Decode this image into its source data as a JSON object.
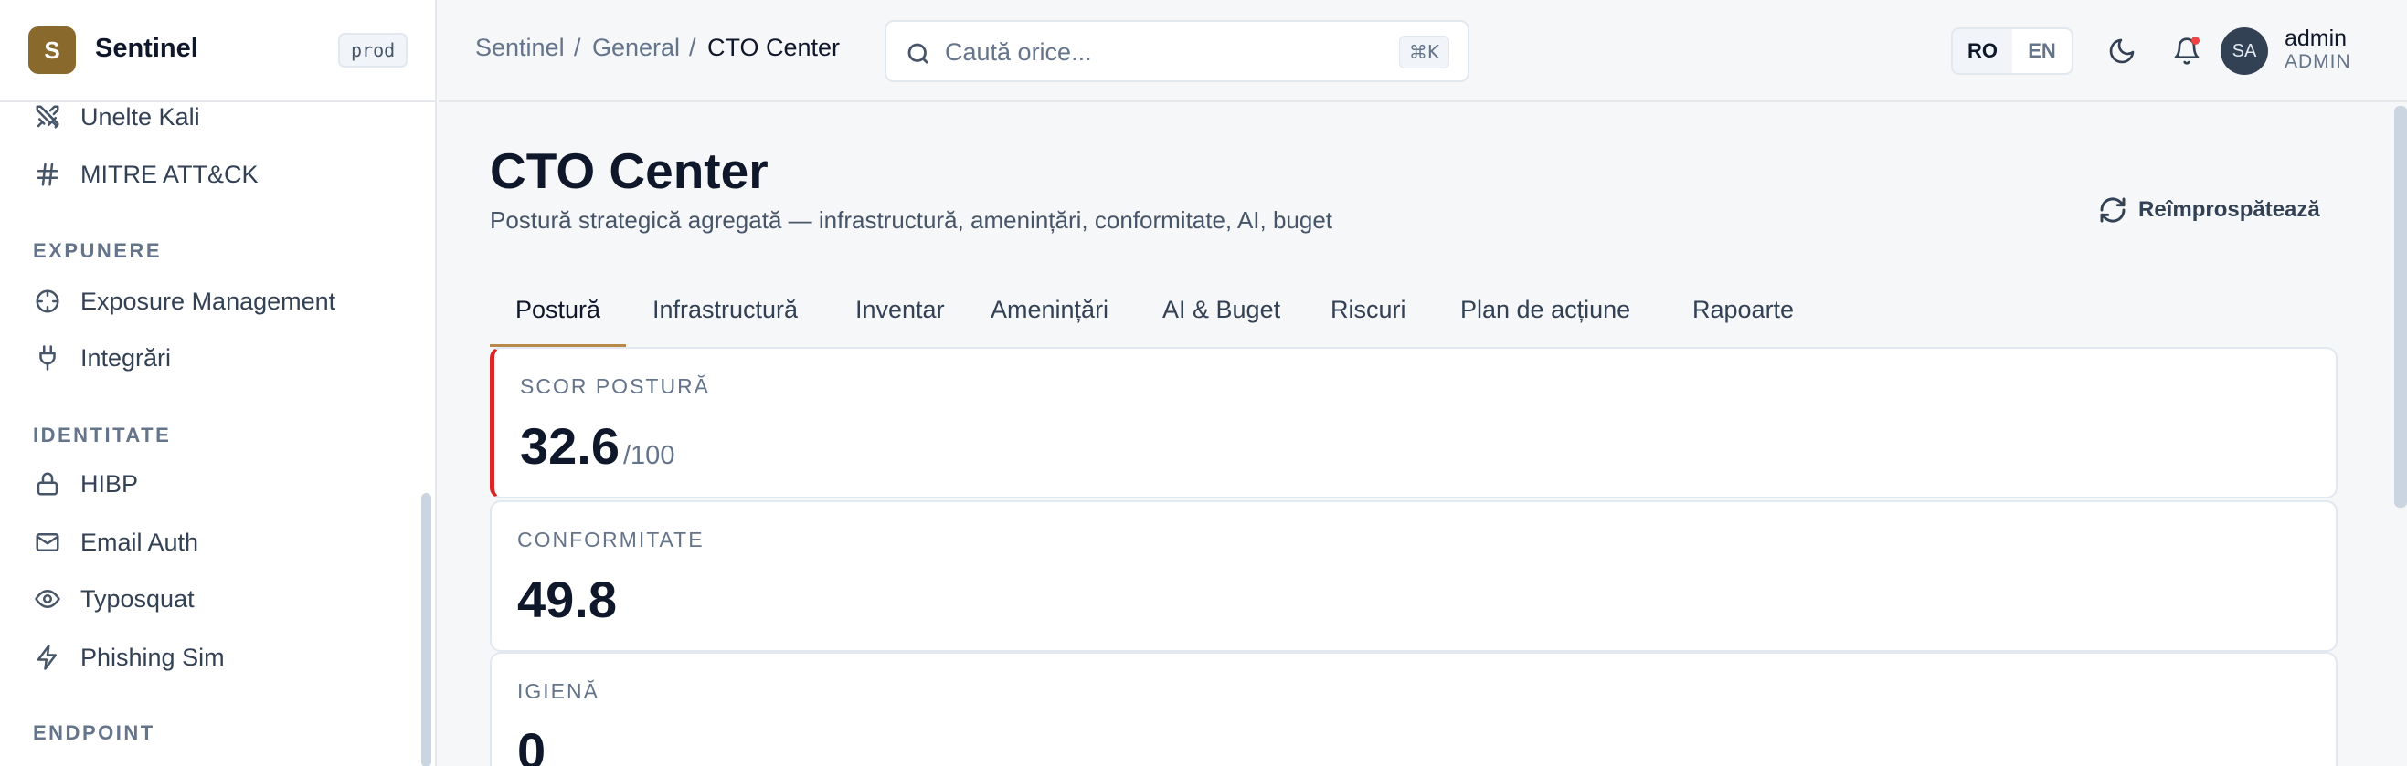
{
  "brand": {
    "logo_letter": "S",
    "name": "Sentinel",
    "env": "prod"
  },
  "sidebar": {
    "items_top": [
      {
        "label": "Unelte Kali",
        "icon": "swords-icon"
      },
      {
        "label": "MITRE ATT&CK",
        "icon": "hash-icon"
      }
    ],
    "sections": [
      {
        "label": "EXPUNERE",
        "items": [
          {
            "label": "Exposure Management",
            "icon": "crosshair-icon"
          },
          {
            "label": "Integrări",
            "icon": "plug-icon"
          }
        ]
      },
      {
        "label": "IDENTITATE",
        "items": [
          {
            "label": "HIBP",
            "icon": "lock-icon"
          },
          {
            "label": "Email Auth",
            "icon": "mail-icon"
          },
          {
            "label": "Typosquat",
            "icon": "eye-icon"
          },
          {
            "label": "Phishing Sim",
            "icon": "zap-icon"
          }
        ]
      },
      {
        "label": "ENDPOINT",
        "items": []
      }
    ]
  },
  "topbar": {
    "breadcrumb": [
      "Sentinel",
      "General",
      "CTO Center"
    ],
    "breadcrumb_sep": "/",
    "search_placeholder": "Caută orice...",
    "search_shortcut": "⌘K",
    "lang": [
      "RO",
      "EN"
    ],
    "lang_active": "RO",
    "user": {
      "initials": "SA",
      "name": "admin",
      "role": "ADMIN"
    }
  },
  "page": {
    "title": "CTO Center",
    "subtitle": "Postură strategică agregată — infrastructură, amenințări, conformitate, AI, buget",
    "refresh_label": "Reîmprospătează",
    "tabs": [
      "Postură",
      "Infrastructură",
      "Inventar",
      "Amenințări",
      "AI & Buget",
      "Riscuri",
      "Plan de acțiune",
      "Rapoarte"
    ],
    "active_tab": "Postură"
  },
  "metrics": [
    {
      "label": "SCOR POSTURĂ",
      "value": "32.6",
      "suffix": "/100",
      "accent": "#dc2626"
    },
    {
      "label": "CONFORMITATE",
      "value": "49.8",
      "suffix": ""
    },
    {
      "label": "IGIENĂ",
      "value": "0",
      "suffix": ""
    }
  ],
  "colors": {
    "brand": "#8a6a2c",
    "tab_active_underline": "#b8894a",
    "notification_dot": "#ef4444",
    "posture_accent": "#dc2626"
  }
}
